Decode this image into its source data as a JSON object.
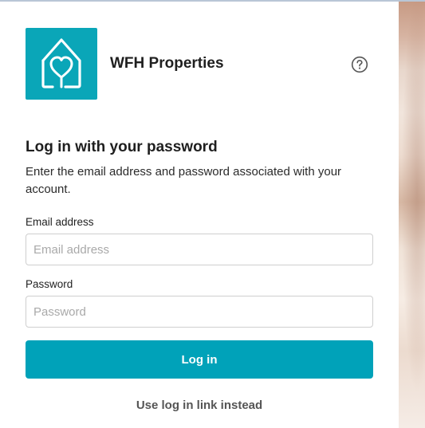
{
  "brand": {
    "name": "WFH Properties",
    "logo_icon": "house-heart-icon",
    "logo_color": "#0aa6b8"
  },
  "help": {
    "icon": "help-circle-icon"
  },
  "form": {
    "title": "Log in with your password",
    "subtitle": "Enter the email address and password associated with your account.",
    "email": {
      "label": "Email address",
      "placeholder": "Email address",
      "value": ""
    },
    "password": {
      "label": "Password",
      "placeholder": "Password",
      "value": ""
    },
    "submit_label": "Log in",
    "alt_link_label": "Use log in link instead"
  },
  "colors": {
    "accent": "#00a2b9",
    "text": "#1f1f1f",
    "muted_link": "#555555"
  }
}
